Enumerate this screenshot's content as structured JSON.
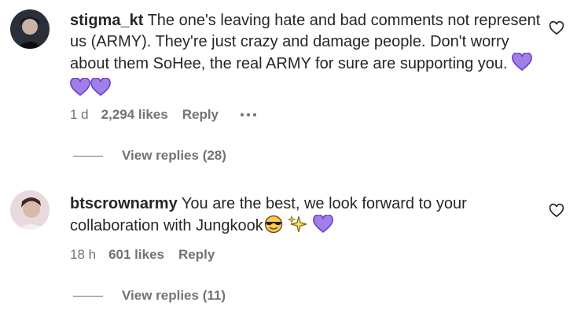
{
  "comments": [
    {
      "username": "stigma_kt",
      "text": "The one's leaving hate and bad comments not represent us (ARMY). They're just crazy and damage people. Don't worry about them SoHee, the real ARMY for sure are supporting you.",
      "time": "1 d",
      "likes": "2,294 likes",
      "reply_label": "Reply",
      "view_replies": "View replies (28)",
      "emojis": [
        "purple-heart",
        "purple-heart",
        "purple-heart"
      ]
    },
    {
      "username": "btscrownarmy",
      "text": "You are the best, we look forward to your collaboration with Jungkook",
      "time": "18 h",
      "likes": "601 likes",
      "reply_label": "Reply",
      "view_replies": "View replies (11)",
      "emojis": [
        "smiling-face-with-sunglasses",
        "sparkles",
        "purple-heart"
      ]
    }
  ],
  "colors": {
    "text": "#262626",
    "secondary": "#737373",
    "purple_heart": "#a27ee8",
    "purple_heart_outline": "#6a3fc8"
  }
}
